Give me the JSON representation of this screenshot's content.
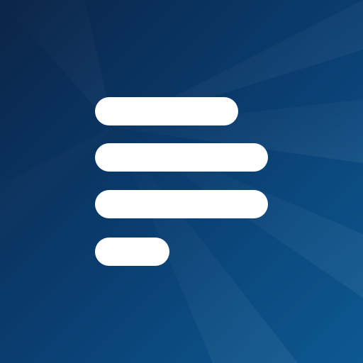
{
  "icon": {
    "name": "text-lines-icon",
    "background_colors": [
      "#0b2447",
      "#0a3a6b",
      "#0b4c82",
      "#0d5890"
    ],
    "glyph_color": "#ffffff"
  }
}
